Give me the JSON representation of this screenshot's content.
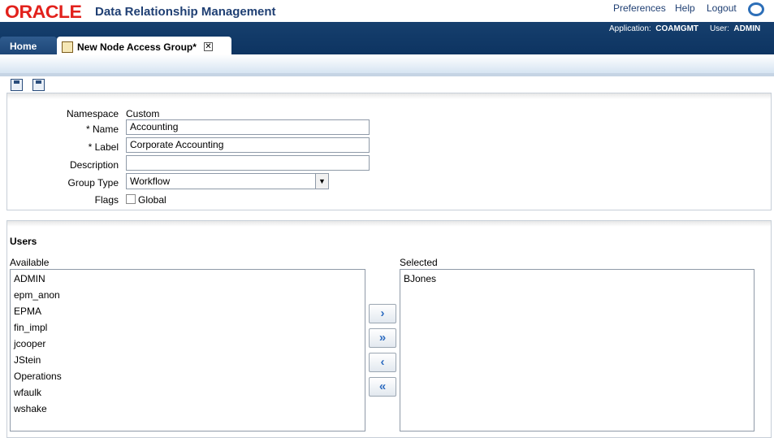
{
  "header": {
    "logo_text": "ORACLE",
    "app_title": "Data Relationship Management",
    "links": [
      "Preferences",
      "Help",
      "Logout"
    ],
    "application_label": "Application:",
    "application_value": "COAMGMT",
    "user_label": "User:",
    "user_value": "ADMIN"
  },
  "tabs": {
    "home": "Home",
    "active": "New Node Access Group*",
    "close": "✕"
  },
  "form": {
    "namespace_label": "Namespace",
    "namespace_value": "Custom",
    "name_label": "* Name",
    "name_value": "Accounting",
    "label_label": "* Label",
    "label_value": "Corporate Accounting",
    "description_label": "Description",
    "description_value": "",
    "group_type_label": "Group Type",
    "group_type_value": "Workflow",
    "flags_label": "Flags",
    "global_label": "Global"
  },
  "users": {
    "section_title": "Users",
    "available_label": "Available",
    "selected_label": "Selected",
    "available": [
      "ADMIN",
      "epm_anon",
      "EPMA",
      "fin_impl",
      "jcooper",
      "JStein",
      "Operations",
      "wfaulk",
      "wshake"
    ],
    "selected": [
      "BJones"
    ],
    "move_buttons": [
      "›",
      "»",
      "‹",
      "«"
    ]
  },
  "colors": {
    "brand_red": "#e2211c",
    "brand_blue": "#1f3f73",
    "bar_blue": "#0d3461"
  }
}
